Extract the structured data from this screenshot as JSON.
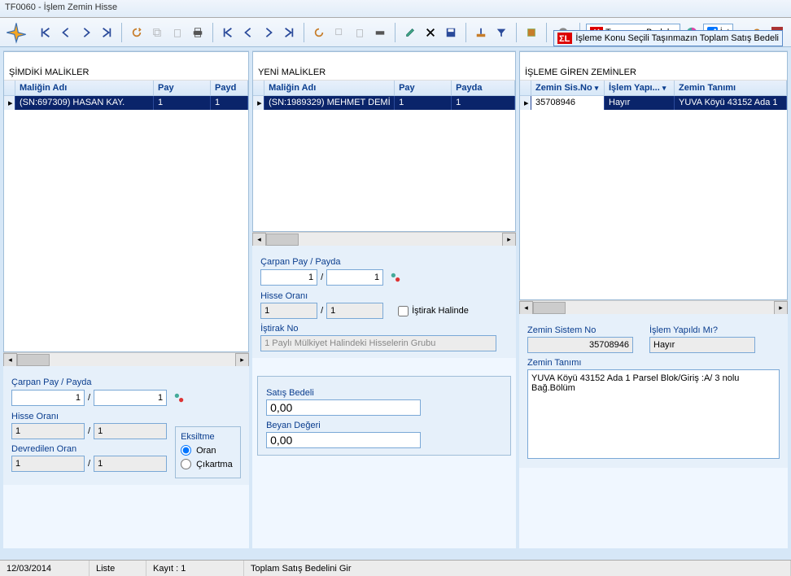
{
  "title": "TF0060 - İşlem Zemin Hisse",
  "toolbar": {
    "tasinmaz_bedel": "Taşınmaz Bedel",
    "ist": "İşt"
  },
  "tooltip": "İşleme Konu Seçili Taşınmazın Toplam Satış Bedeli",
  "left": {
    "title": "ŞİMDİKİ MALİKLER",
    "cols": {
      "name": "Maliğin Adı",
      "pay": "Pay",
      "payda": "Payd"
    },
    "row": {
      "name": "(SN:697309) HASAN KAY.",
      "pay": "1",
      "payda": "1"
    },
    "carpan_label": "Çarpan Pay / Payda",
    "carpan_pay": "1",
    "carpan_payda": "1",
    "hisse_label": "Hisse Oranı",
    "hisse_pay": "1",
    "hisse_payda": "1",
    "devredilen_label": "Devredilen Oran",
    "dev_pay": "1",
    "dev_payda": "1",
    "eksiltme": "Eksiltme",
    "oran": "Oran",
    "cikartma": "Çıkartma"
  },
  "mid": {
    "title": "YENİ MALİKLER",
    "cols": {
      "name": "Maliğin Adı",
      "pay": "Pay",
      "payda": "Payda"
    },
    "row": {
      "name": "(SN:1989329) MEHMET DEMİ",
      "pay": "1",
      "payda": "1"
    },
    "carpan_label": "Çarpan Pay / Payda",
    "carpan_pay": "1",
    "carpan_payda": "1",
    "hisse_label": "Hisse Oranı",
    "hisse_pay": "1",
    "hisse_payda": "1",
    "istirak_halinde": "İştirak Halinde",
    "istirak_no_label": "İştirak No",
    "istirak_no": "1 Paylı Mülkiyet Halindeki Hisselerin Grubu",
    "satis_label": "Satış Bedeli",
    "satis_val": "0,00",
    "beyan_label": "Beyan Değeri",
    "beyan_val": "0,00"
  },
  "right": {
    "title": "İŞLEME GİREN ZEMİNLER",
    "cols": {
      "sisno": "Zemin Sis.No",
      "islem": "İşlem Yapı...",
      "tanim": "Zemin Tanımı"
    },
    "row": {
      "sisno": "35708946",
      "islem": "Hayır",
      "tanim": "YUVA Köyü 43152 Ada 1"
    },
    "sisno_label": "Zemin Sistem No",
    "sisno_val": "35708946",
    "yapildi_label": "İşlem Yapıldı Mı?",
    "yapildi_val": "Hayır",
    "tanim_label": "Zemin Tanımı",
    "tanim_val": "YUVA Köyü 43152 Ada 1 Parsel Blok/Giriş :A/ 3 nolu Bağ.Bölüm"
  },
  "status": {
    "date": "12/03/2014",
    "mode": "Liste",
    "kayit": "Kayıt : 1",
    "msg": "Toplam Satış Bedelini Gir"
  }
}
